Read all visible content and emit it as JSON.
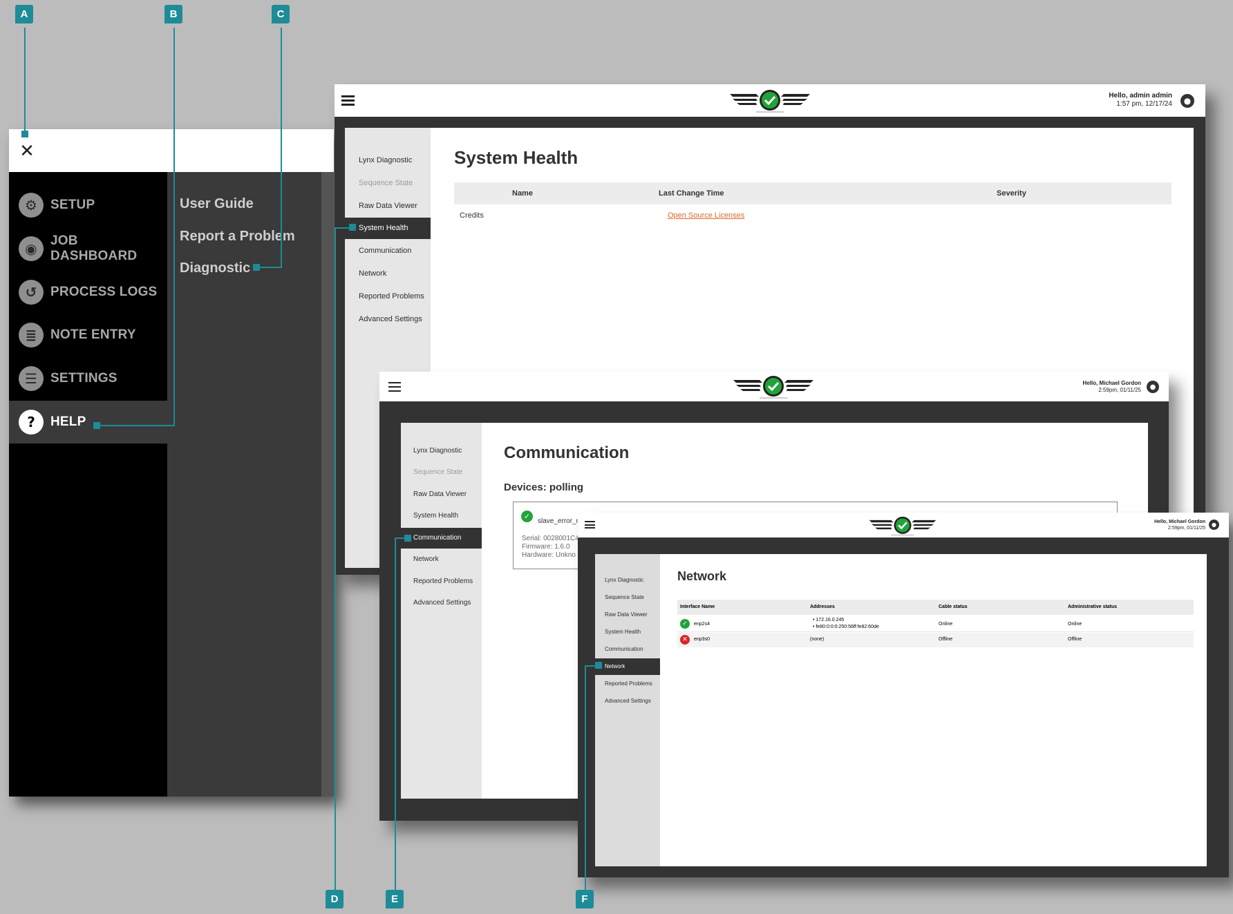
{
  "callouts": [
    "A",
    "B",
    "C",
    "D",
    "E",
    "F"
  ],
  "menu": {
    "close_icon": "close-icon",
    "items": [
      {
        "label": "SETUP",
        "icon": "gear-icon",
        "glyph": "⚙"
      },
      {
        "label": "JOB DASHBOARD",
        "icon": "eye-icon",
        "glyph": "◉"
      },
      {
        "label": "PROCESS LOGS",
        "icon": "history-icon",
        "glyph": "↺"
      },
      {
        "label": "NOTE ENTRY",
        "icon": "clipboard-icon",
        "glyph": "≣"
      },
      {
        "label": "SETTINGS",
        "icon": "sliders-icon",
        "glyph": "☰"
      },
      {
        "label": "HELP",
        "icon": "help-icon",
        "glyph": "?"
      }
    ],
    "help_sub": [
      "User Guide",
      "Report a Problem",
      "Diagnostic"
    ]
  },
  "diag_sidebar": [
    "Lynx Diagnostic",
    "Sequence State",
    "Raw Data Viewer",
    "System Health",
    "Communication",
    "Network",
    "Reported Problems",
    "Advanced Settings"
  ],
  "win1": {
    "user": "Hello, admin admin",
    "time": "1:57 pm, 12/17/24",
    "title": "System Health",
    "headers": [
      "Name",
      "Last Change Time",
      "Severity"
    ],
    "row": {
      "name": "Credits",
      "link": "Open Source Licenses"
    }
  },
  "win2": {
    "user": "Hello, Michael Gordon",
    "time": "2:59pm, 01/11/25",
    "title": "Communication",
    "subtitle": "Devices: polling",
    "device": {
      "name": "slave_error_n",
      "serial": "Serial: 0028001C4",
      "firmware": "Firmware: 1.6.0",
      "hardware": "Hardware: Unkno"
    }
  },
  "win3": {
    "user": "Hello, Michael Gordon",
    "time": "2:59pm, 01/11/25",
    "title": "Network",
    "headers": [
      "Interface Name",
      "Addresses",
      "Cable status",
      "Administrative status"
    ],
    "rows": [
      {
        "name": "enp2s4",
        "addr1": "172.16.0.245",
        "addr2": "fe80:0:0:0:250:56ff:fe82:60de",
        "cable": "Online",
        "admin": "Online",
        "ok": true
      },
      {
        "name": "enp3s0",
        "addr1": "(none)",
        "addr2": "",
        "cable": "Offline",
        "admin": "Offline",
        "ok": false
      }
    ]
  },
  "colors": {
    "accent": "#1d8c98",
    "ok": "#22a33a",
    "error": "#d9262b",
    "link": "#e0662a"
  }
}
